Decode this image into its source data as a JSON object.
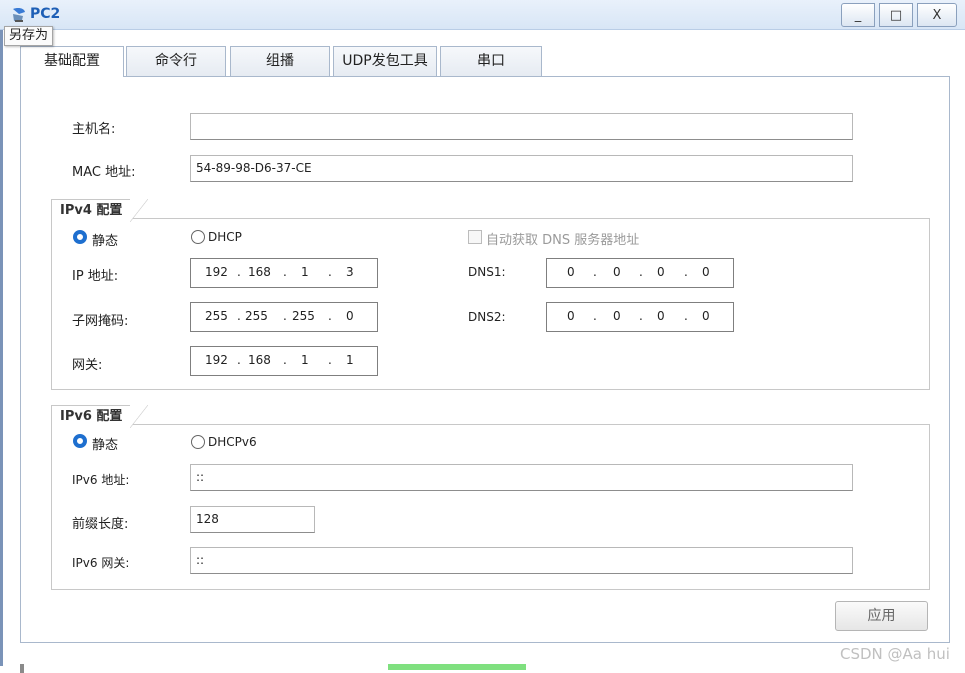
{
  "window": {
    "title": "PC2",
    "buttons": {
      "minimize": "_",
      "maximize": "□",
      "close": "X"
    }
  },
  "tooltip": {
    "save_as": "另存为"
  },
  "tabs": [
    {
      "label": "基础配置",
      "active": true
    },
    {
      "label": "命令行",
      "active": false
    },
    {
      "label": "组播",
      "active": false
    },
    {
      "label": "UDP发包工具",
      "active": false
    },
    {
      "label": "串口",
      "active": false
    }
  ],
  "basic": {
    "hostname_label": "主机名:",
    "hostname_value": "",
    "mac_label": "MAC 地址:",
    "mac_value": "54-89-98-D6-37-CE"
  },
  "ipv4": {
    "group_title": "IPv4 配置",
    "static_label": "静态",
    "dhcp_label": "DHCP",
    "auto_dns_label": "自动获取 DNS 服务器地址",
    "ip_label": "IP 地址:",
    "ip": [
      "192",
      "168",
      "1",
      "3"
    ],
    "mask_label": "子网掩码:",
    "mask": [
      "255",
      "255",
      "255",
      "0"
    ],
    "gateway_label": "网关:",
    "gateway": [
      "192",
      "168",
      "1",
      "1"
    ],
    "dns1_label": "DNS1:",
    "dns1": [
      "0",
      "0",
      "0",
      "0"
    ],
    "dns2_label": "DNS2:",
    "dns2": [
      "0",
      "0",
      "0",
      "0"
    ]
  },
  "ipv6": {
    "group_title": "IPv6 配置",
    "static_label": "静态",
    "dhcp_label": "DHCPv6",
    "address_label": "IPv6 地址:",
    "address_value": "::",
    "prefix_label": "前缀长度:",
    "prefix_value": "128",
    "gateway_label": "IPv6 网关:",
    "gateway_value": "::"
  },
  "apply_label": "应用",
  "watermark": "CSDN @Aa hui",
  "colors": {
    "accent": "#1e6fcf",
    "title": "#1e5fb6"
  }
}
